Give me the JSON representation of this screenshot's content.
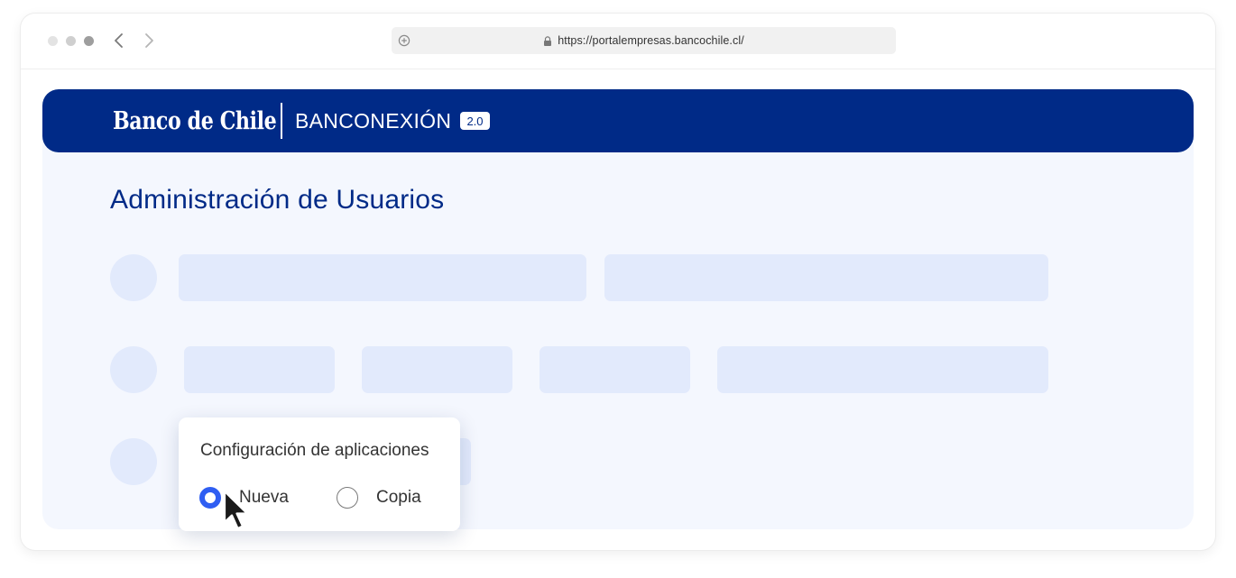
{
  "browser": {
    "url": "https://portalempresas.bancochile.cl/"
  },
  "header": {
    "logo_text": "Banco de Chile",
    "product_name": "BANCONEXIÓN",
    "version": "2.0"
  },
  "page": {
    "title": "Administración de Usuarios"
  },
  "popup": {
    "title": "Configuración de aplicaciones",
    "options": [
      {
        "label": "Nueva",
        "selected": true
      },
      {
        "label": "Copia",
        "selected": false
      }
    ]
  },
  "colors": {
    "brand_blue": "#002a87",
    "accent_blue": "#2f5ef2",
    "skeleton": "#e2eafc",
    "content_bg": "#f4f7fe"
  },
  "icons": [
    "back-arrow-icon",
    "forward-arrow-icon",
    "new-tab-icon",
    "lock-icon",
    "mouse-cursor-icon"
  ]
}
